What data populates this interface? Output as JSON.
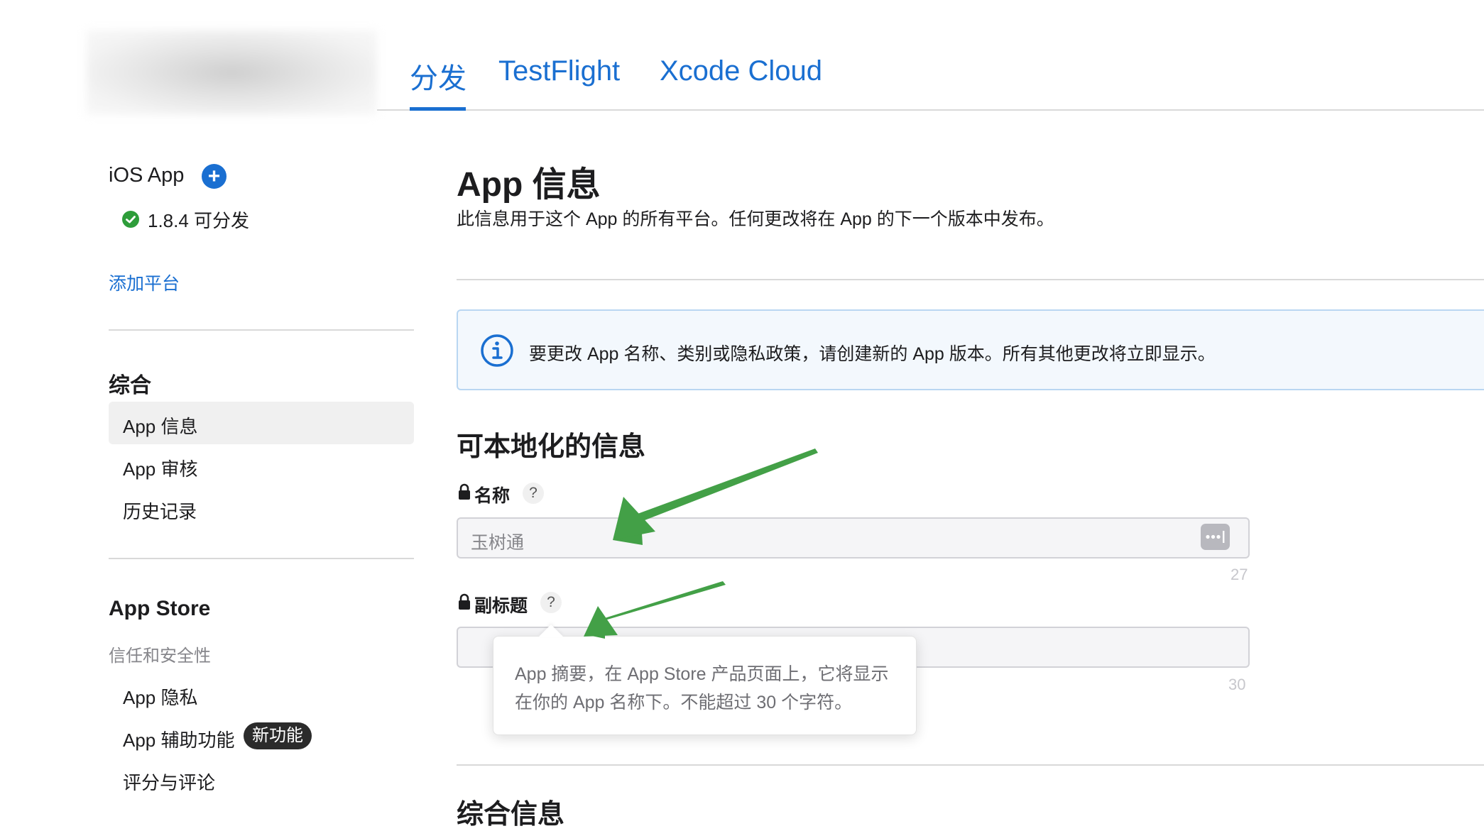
{
  "tabs": [
    {
      "label": "分发",
      "active": true
    },
    {
      "label": "TestFlight",
      "active": false
    },
    {
      "label": "Xcode Cloud",
      "active": false
    }
  ],
  "sidebar": {
    "platform_title": "iOS App",
    "version_status": "1.8.4 可分发",
    "add_platform": "添加平台",
    "general_heading": "综合",
    "general_items": [
      "App 信息",
      "App 审核",
      "历史记录"
    ],
    "store_heading": "App Store",
    "trust_subheading": "信任和安全性",
    "store_items": [
      "App 隐私",
      "App 辅助功能",
      "评分与评论"
    ],
    "new_badge": "新功能"
  },
  "main": {
    "title": "App 信息",
    "description": "此信息用于这个 App 的所有平台。任何更改将在 App 的下一个版本中发布。",
    "info_banner": "要更改 App 名称、类别或隐私政策，请创建新的 App 版本。所有其他更改将立即显示。",
    "localizable_title": "可本地化的信息",
    "name_label": "名称",
    "name_value": "玉树通",
    "name_remaining": "27",
    "subtitle_label": "副标题",
    "subtitle_remaining": "30",
    "help_mark": "?",
    "tooltip_text": "App 摘要，在 App Store 产品页面上，它将显示在你的 App 名称下。不能超过 30 个字符。",
    "general_info_title": "综合信息"
  },
  "colors": {
    "accent": "#1a6fd1",
    "success": "#2e9d3a",
    "annotation_arrow": "#43a047"
  }
}
